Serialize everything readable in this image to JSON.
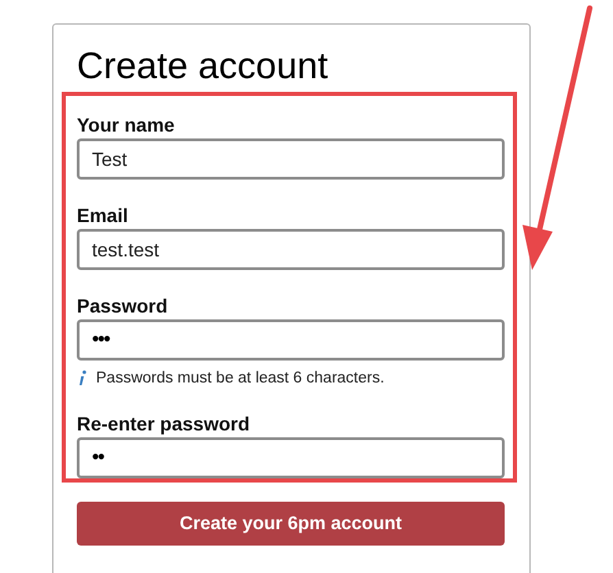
{
  "title": "Create account",
  "fields": [
    {
      "label": "Your name",
      "value": "Test",
      "kind": "text"
    },
    {
      "label": "Email",
      "value": "test.test",
      "kind": "text"
    },
    {
      "label": "Password",
      "value": "•••",
      "kind": "password",
      "hint": "Passwords must be at least 6 characters."
    },
    {
      "label": "Re-enter password",
      "value": "••",
      "kind": "password"
    }
  ],
  "submit": "Create your 6pm account"
}
